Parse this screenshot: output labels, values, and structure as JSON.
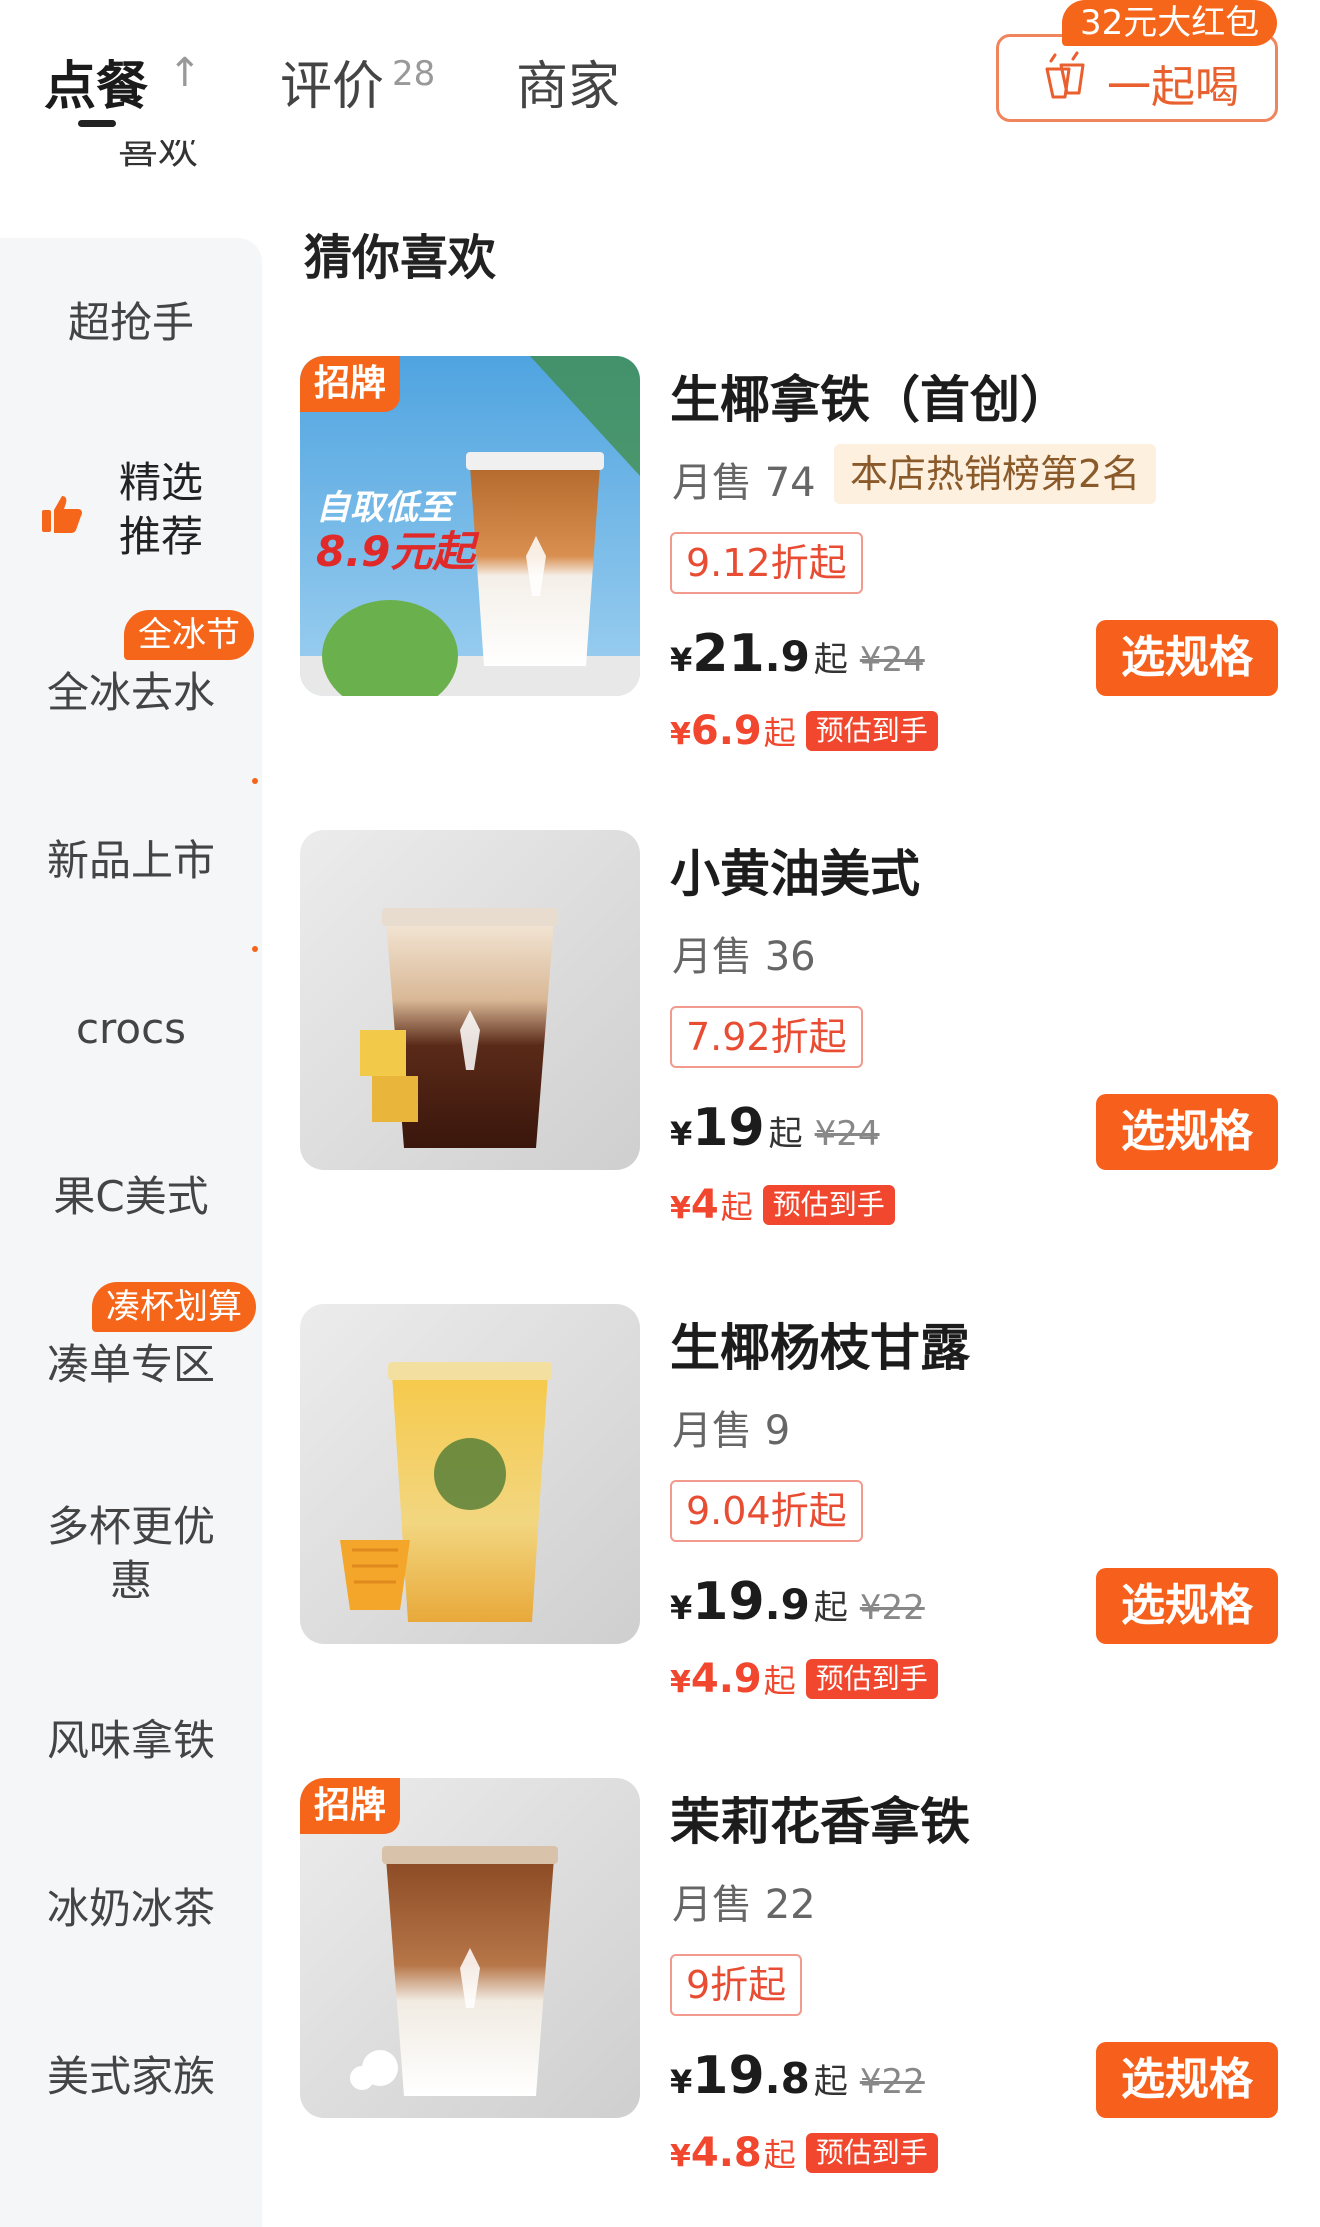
{
  "tabs": {
    "order": "点餐",
    "reviews": "评价",
    "reviews_count": "28",
    "merchant": "商家"
  },
  "group_drink": {
    "label": "一起喝",
    "badge": "32元大红包"
  },
  "sidebar_scrolled_label": "喜欢",
  "section_title": "猜你喜欢",
  "sidebar": {
    "items": [
      {
        "label": "超抢手"
      },
      {
        "label": "精选\n推荐",
        "line1": "精选",
        "line2": "推荐"
      },
      {
        "label": "全冰去水",
        "badge": "全冰节"
      },
      {
        "label": "新品上市"
      },
      {
        "label": "crocs"
      },
      {
        "label": "果C美式"
      },
      {
        "label": "凑单专区",
        "badge": "凑杯划算"
      },
      {
        "label": "多杯更优惠",
        "line1": "多杯更优",
        "line2": "惠"
      },
      {
        "label": "风味拿铁"
      },
      {
        "label": "冰奶冰茶"
      },
      {
        "label": "美式家族"
      }
    ]
  },
  "products": [
    {
      "name": "生椰拿铁（首创）",
      "badge": "招牌",
      "sales": "月售 74",
      "rank": "本店热销榜第2名",
      "discount": "9.12折起",
      "price_yen": "¥",
      "price_int": "21",
      "price_dec": ".9",
      "price_qi": "起",
      "price_orig": "¥24",
      "est_yen": "¥",
      "est_val": "6.9",
      "est_qi": "起",
      "est_tag": "预估到手",
      "button": "选规格",
      "promo_text_1": "自取低至",
      "promo_text_2": "8.9元起"
    },
    {
      "name": "小黄油美式",
      "sales": "月售 36",
      "discount": "7.92折起",
      "price_yen": "¥",
      "price_int": "19",
      "price_dec": "",
      "price_qi": "起",
      "price_orig": "¥24",
      "est_yen": "¥",
      "est_val": "4",
      "est_qi": "起",
      "est_tag": "预估到手",
      "button": "选规格"
    },
    {
      "name": "生椰杨枝甘露",
      "sales": "月售 9",
      "discount": "9.04折起",
      "price_yen": "¥",
      "price_int": "19",
      "price_dec": ".9",
      "price_qi": "起",
      "price_orig": "¥22",
      "est_yen": "¥",
      "est_val": "4.9",
      "est_qi": "起",
      "est_tag": "预估到手",
      "button": "选规格"
    },
    {
      "name": "茉莉花香拿铁",
      "badge": "招牌",
      "sales": "月售 22",
      "discount": "9折起",
      "price_yen": "¥",
      "price_int": "19",
      "price_dec": ".8",
      "price_qi": "起",
      "price_orig": "¥22",
      "est_yen": "¥",
      "est_val": "4.8",
      "est_qi": "起",
      "est_tag": "预估到手",
      "button": "选规格"
    }
  ],
  "colors": {
    "accent": "#f6601c",
    "price_red": "#f0472e",
    "sidebar_bg": "#f5f6f8"
  }
}
